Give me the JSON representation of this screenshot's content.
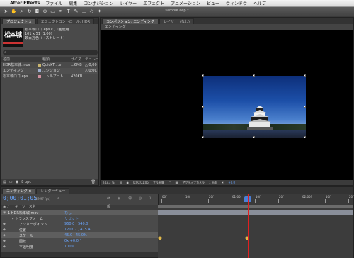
{
  "menubar": {
    "apple": "",
    "app_name": "After Effects",
    "items": [
      "ファイル",
      "編集",
      "コンポジション",
      "レイヤー",
      "エフェクト",
      "アニメーション",
      "ビュー",
      "ウィンドウ",
      "ヘルプ"
    ]
  },
  "document_title": "sample.aep *",
  "project_panel": {
    "tabs": [
      "プロジェクト ×",
      "エフェクトコントロール: HDR"
    ],
    "thumb_text": "松本城",
    "info": [
      "松本城ロゴ.eps ▾ , 1回使用",
      "101 x 51 (1.00)",
      "",
      "数百万色 + (ストレート)"
    ],
    "search_placeholder": "",
    "columns": [
      "名前",
      "種類",
      "サイズ",
      "デュレーション"
    ],
    "rows": [
      {
        "name": "HDR松本城.mov",
        "type": "QuickTi...e",
        "size": "...6MB",
        "rest": "△ 0;00",
        "color": "#c8b46e"
      },
      {
        "name": "エンディング",
        "type": "...ジション",
        "size": "",
        "rest": "△ 0;0C",
        "color": "#a0b0d0"
      },
      {
        "name": "松本城ロゴ.eps",
        "type": "...トルアート",
        "size": "420KB",
        "rest": "",
        "color": "#d090a0"
      }
    ],
    "footer": [
      "8 bpc"
    ]
  },
  "comp_panel": {
    "tabs": [
      "コンポジション: エンディング",
      "レイヤー: (なし)"
    ],
    "subtab": "エンディング",
    "viewer_bar": [
      "(43.3 %)",
      "0;00;01;05",
      "フル画質",
      "アクティブカメラ",
      "1 画面",
      "+0.0"
    ]
  },
  "timeline": {
    "tabs": [
      "エンディング ×",
      "レンダーキュー"
    ],
    "timecode": "0;00;01;05",
    "fps": "(29.97 fps)",
    "columns": [
      "#",
      "ソース名",
      "親"
    ],
    "rows": [
      {
        "label": "1   HDR松本城.mov",
        "value": "なし",
        "indent": 0,
        "sel": true
      },
      {
        "label": "▾ トランスフォーム",
        "value": "リセット",
        "indent": 6,
        "sel": false
      },
      {
        "label": "アンカーポイント",
        "value": "960.0 , 540.0",
        "indent": 16,
        "sel": false
      },
      {
        "label": "位置",
        "value": "1207.7 , 475.4",
        "indent": 16,
        "sel": false
      },
      {
        "label": "スケール",
        "value": "45.0 , 45.0%",
        "indent": 16,
        "sel": true
      },
      {
        "label": "回転",
        "value": "0x +0.0 °",
        "indent": 16,
        "sel": false
      },
      {
        "label": "不透明度",
        "value": "100%",
        "indent": 16,
        "sel": false
      }
    ],
    "ruler_labels": [
      "00f",
      "10f",
      "20f",
      "01:00f",
      "10f",
      "20f",
      "02:00f",
      "10f",
      "20f"
    ],
    "playhead_frac": 0.46
  },
  "colors": {
    "accent": "#6aa6ff",
    "playhead": "#e02020",
    "keyframe": "#e0b84a"
  }
}
